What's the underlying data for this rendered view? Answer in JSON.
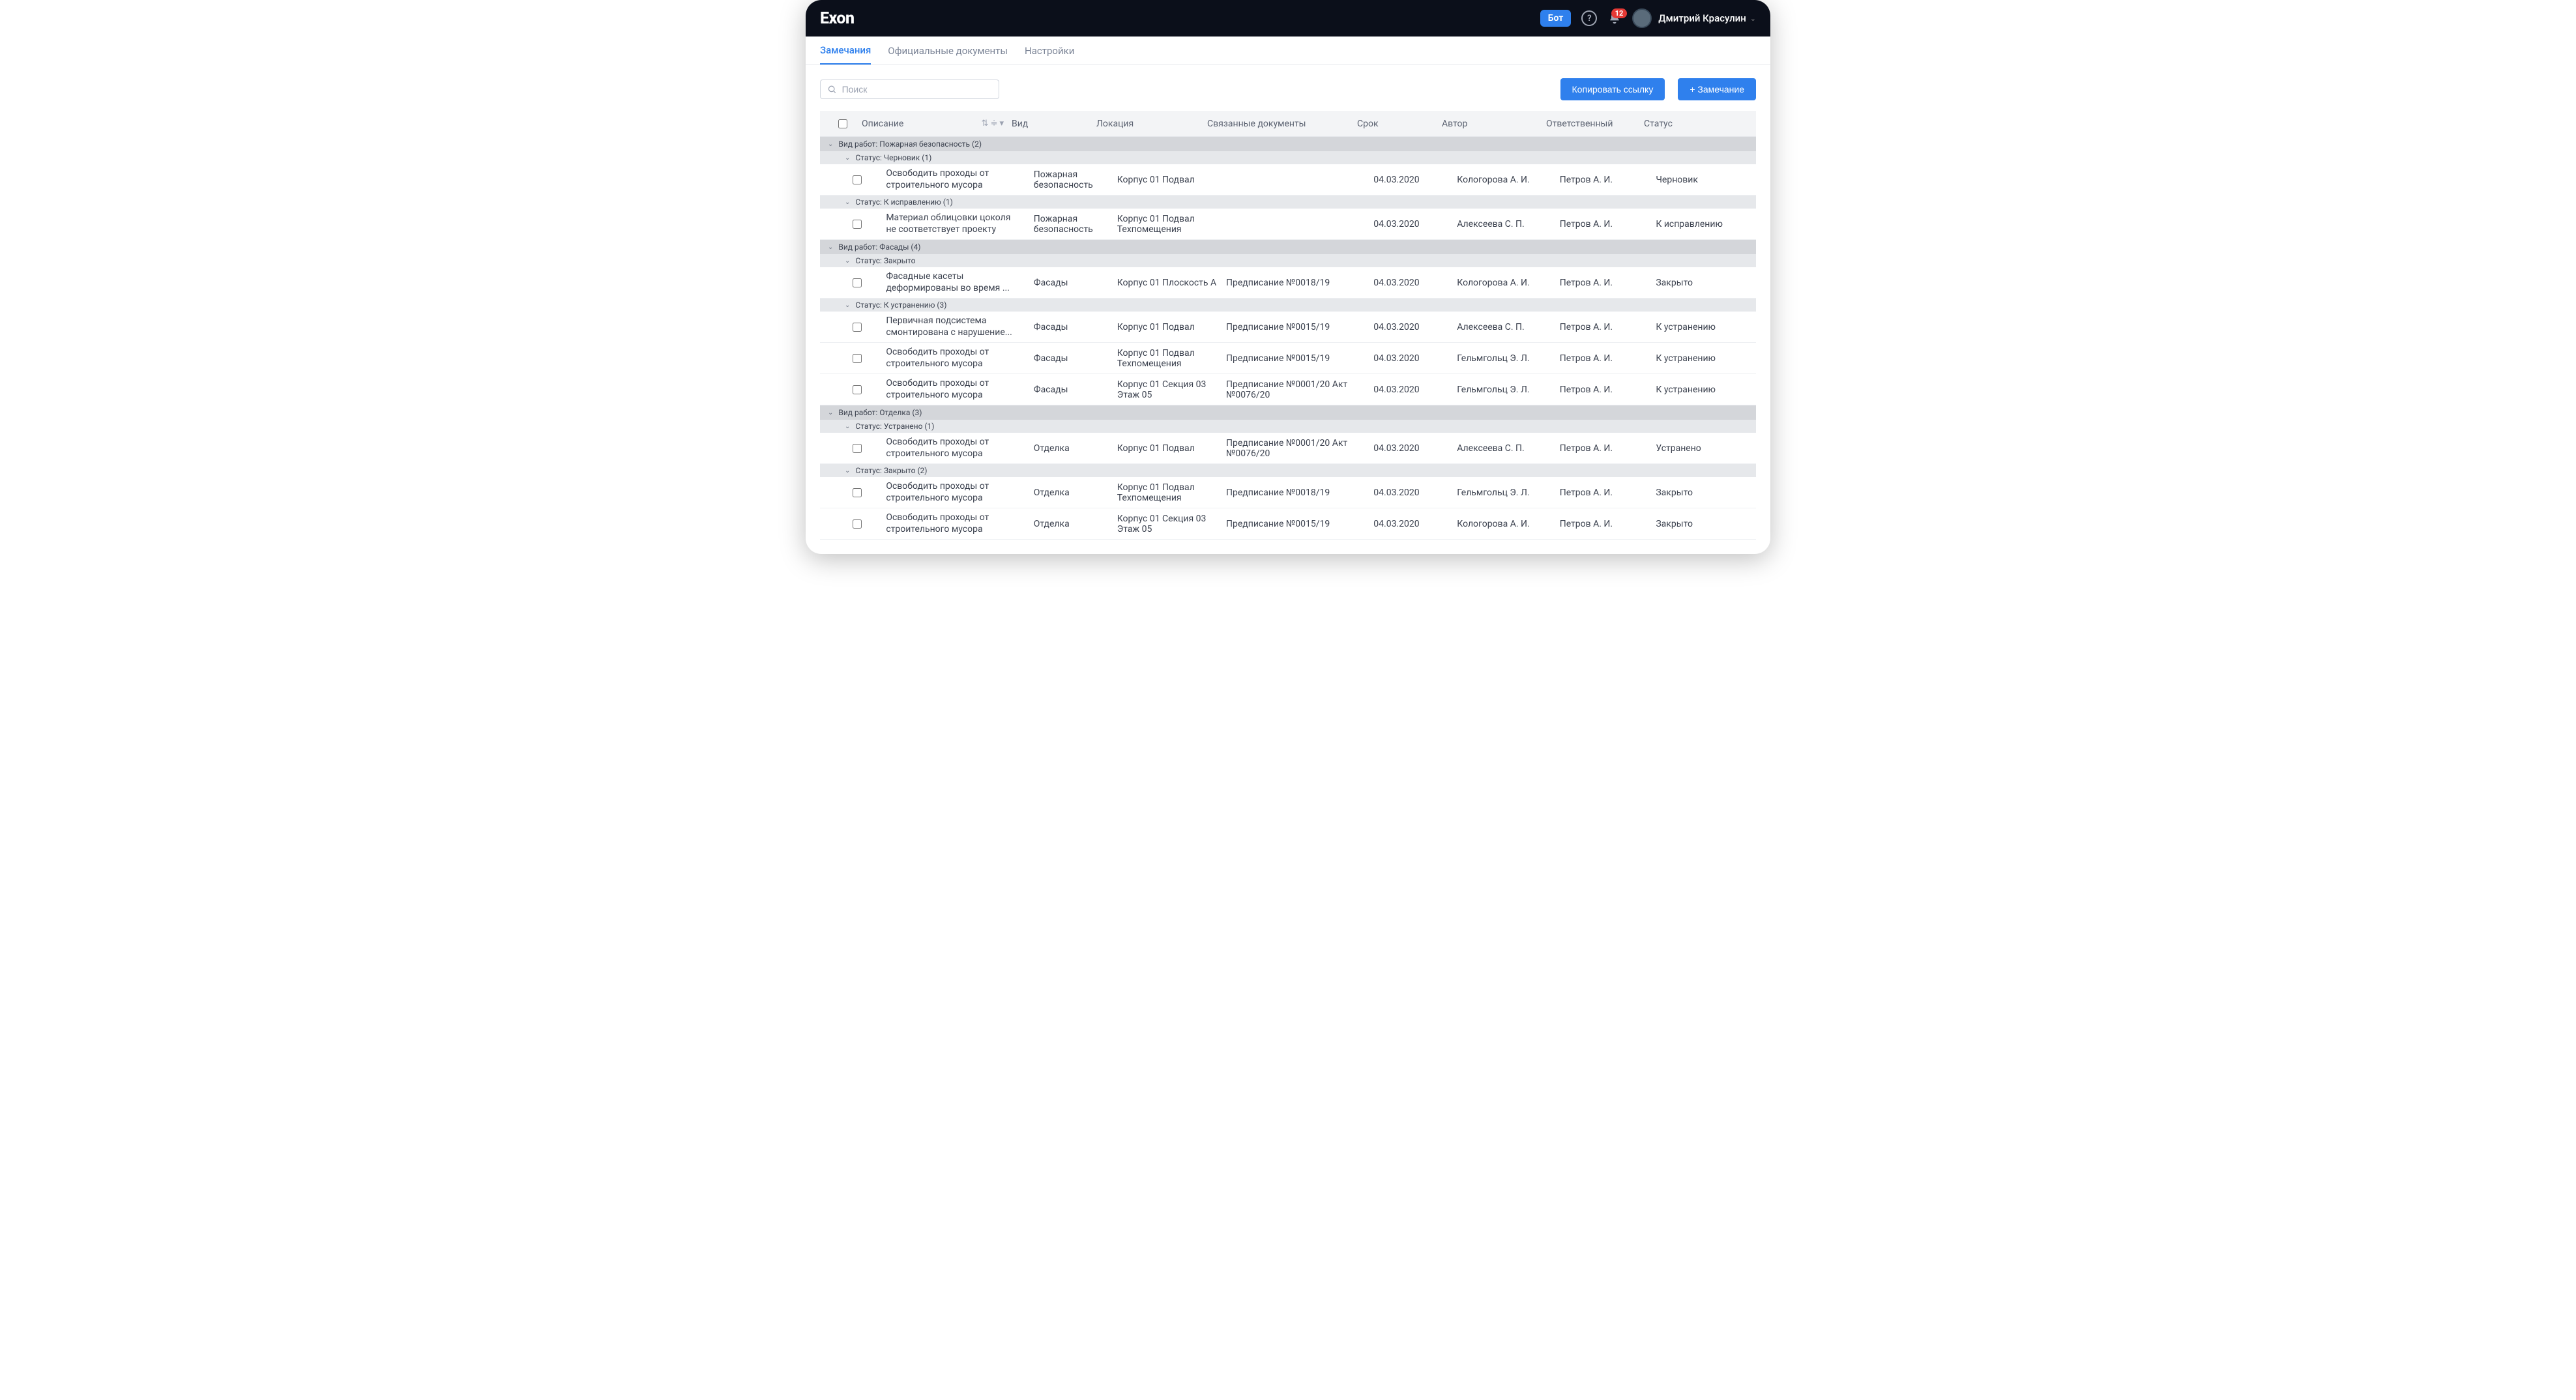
{
  "header": {
    "brand": "Exon",
    "bot_label": "Бот",
    "notification_count": "12",
    "user_name": "Дмитрий Красулин"
  },
  "nav": {
    "tabs": [
      {
        "label": "Замечания",
        "active": true
      },
      {
        "label": "Официальные документы",
        "active": false
      },
      {
        "label": "Настройки",
        "active": false
      }
    ]
  },
  "toolbar": {
    "search_placeholder": "Поиск",
    "copy_link_label": "Копировать ссылку",
    "add_note_label": "+ Замечание"
  },
  "columns": {
    "description": "Описание",
    "kind": "Вид",
    "location": "Локация",
    "documents": "Связанные документы",
    "deadline": "Срок",
    "author": "Автор",
    "responsible": "Ответственный",
    "status": "Статус"
  },
  "groups": [
    {
      "title": "Вид работ: Пожарная безопасность (2)",
      "subgroups": [
        {
          "title": "Статус: Черновик (1)",
          "rows": [
            {
              "desc": "Освободить проходы от строительного мусора",
              "kind": "Пожарная безопасность",
              "loc": "Корпус 01 Подвал",
              "doc": "",
              "date": "04.03.2020",
              "auth": "Кологорова А. И.",
              "resp": "Петров А. И.",
              "status": "Черновик"
            }
          ]
        },
        {
          "title": "Статус: К исправлению (1)",
          "rows": [
            {
              "desc": "Материал облицовки цоколя не соответствует проекту",
              "kind": "Пожарная безопасность",
              "loc": "Корпус 01 Подвал Техпомещения",
              "doc": "",
              "date": "04.03.2020",
              "auth": "Алексеева С. П.",
              "resp": "Петров А. И.",
              "status": "К исправлению"
            }
          ]
        }
      ]
    },
    {
      "title": "Вид работ: Фасады (4)",
      "subgroups": [
        {
          "title": "Статус: Закрыто",
          "rows": [
            {
              "desc": "Фасадные касеты деформированы во время ...",
              "kind": "Фасады",
              "loc": "Корпус 01 Плоскость А",
              "doc": "Предписание №0018/19",
              "date": "04.03.2020",
              "auth": "Кологорова А. И.",
              "resp": "Петров А. И.",
              "status": "Закрыто"
            }
          ]
        },
        {
          "title": "Статус: К устранению (3)",
          "rows": [
            {
              "desc": "Первичная подсистема смонтирована с нарушение...",
              "kind": "Фасады",
              "loc": "Корпус 01 Подвал",
              "doc": "Предписание №0015/19",
              "date": "04.03.2020",
              "auth": "Алексеева С. П.",
              "resp": "Петров А. И.",
              "status": "К устранению"
            },
            {
              "desc": "Освободить проходы от строительного мусора",
              "kind": "Фасады",
              "loc": "Корпус 01 Подвал Техпомещения",
              "doc": "Предписание №0015/19",
              "date": "04.03.2020",
              "auth": "Гельмгольц Э. Л.",
              "resp": "Петров А. И.",
              "status": "К устранению"
            },
            {
              "desc": "Освободить проходы от строительного мусора",
              "kind": "Фасады",
              "loc": "Корпус 01 Секция 03 Этаж 05",
              "doc": "Предписание №0001/20 Акт №0076/20",
              "date": "04.03.2020",
              "auth": "Гельмгольц Э. Л.",
              "resp": "Петров А. И.",
              "status": "К устранению"
            }
          ]
        }
      ]
    },
    {
      "title": "Вид работ: Отделка (3)",
      "subgroups": [
        {
          "title": "Статус: Устранено (1)",
          "rows": [
            {
              "desc": "Освободить проходы от строительного мусора",
              "kind": "Отделка",
              "loc": "Корпус 01 Подвал",
              "doc": "Предписание №0001/20 Акт №0076/20",
              "date": "04.03.2020",
              "auth": "Алексеева С. П.",
              "resp": "Петров А. И.",
              "status": "Устранено"
            }
          ]
        },
        {
          "title": "Статус: Закрыто (2)",
          "rows": [
            {
              "desc": "Освободить проходы от строительного мусора",
              "kind": "Отделка",
              "loc": "Корпус 01 Подвал Техпомещения",
              "doc": "Предписание №0018/19",
              "date": "04.03.2020",
              "auth": "Гельмгольц Э. Л.",
              "resp": "Петров А. И.",
              "status": "Закрыто"
            },
            {
              "desc": "Освободить проходы от строительного мусора",
              "kind": "Отделка",
              "loc": "Корпус 01 Секция 03 Этаж 05",
              "doc": "Предписание №0015/19",
              "date": "04.03.2020",
              "auth": "Кологорова А. И.",
              "resp": "Петров А. И.",
              "status": "Закрыто"
            }
          ]
        }
      ]
    }
  ]
}
